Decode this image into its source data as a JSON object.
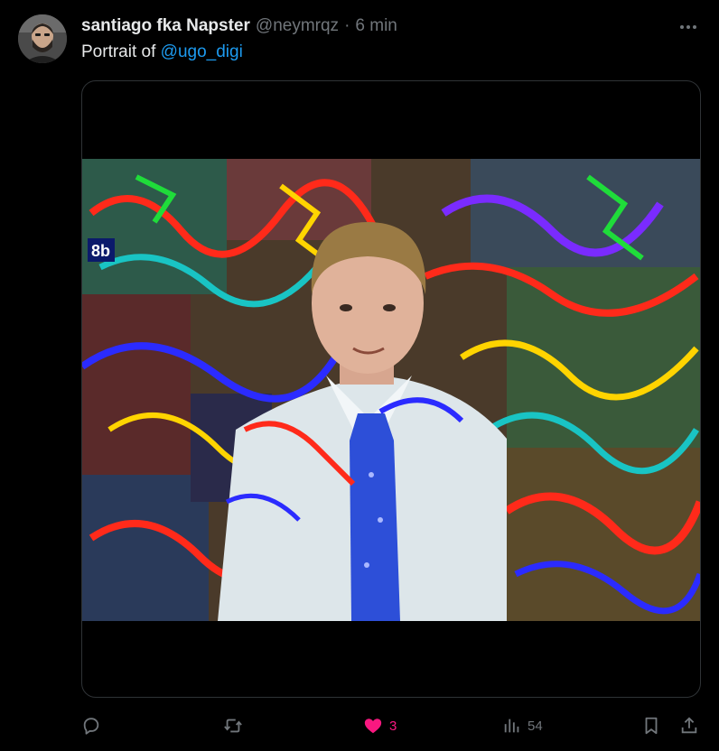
{
  "tweet": {
    "author": {
      "display_name": "santiago fka Napster",
      "handle": "@neymrqz",
      "avatar_icon": "user-avatar"
    },
    "separator": "·",
    "timestamp": "6 min",
    "text_prefix": "Portrait of ",
    "mention": "@ugo_digi",
    "media": {
      "kind": "image",
      "corner_mark": "8b"
    },
    "actions": {
      "reply": {
        "icon": "reply-icon",
        "count": ""
      },
      "retweet": {
        "icon": "retweet-icon",
        "count": ""
      },
      "like": {
        "icon": "heart-icon",
        "count": "3",
        "liked": true,
        "color": "#f91880"
      },
      "views": {
        "icon": "views-icon",
        "count": "54"
      },
      "bookmark": {
        "icon": "bookmark-icon"
      },
      "share": {
        "icon": "share-icon"
      }
    }
  },
  "colors": {
    "background": "#000000",
    "primary_text": "#e7e9ea",
    "secondary_text": "#71767b",
    "link": "#1d9bf0",
    "border": "#2f3336",
    "like": "#f91880"
  }
}
